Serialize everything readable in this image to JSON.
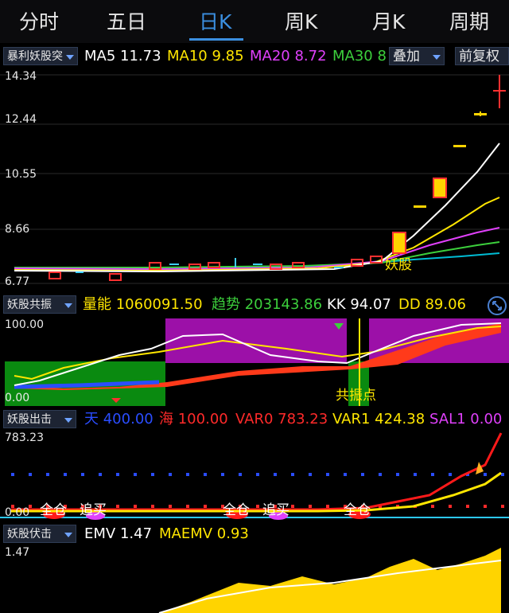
{
  "tabs": [
    "分时",
    "五日",
    "日K",
    "周K",
    "月K",
    "周期"
  ],
  "active_tab": "日K",
  "main_row": {
    "indicator_button": "暴利妖股突",
    "ma": [
      {
        "label": "MA5",
        "value": "11.73",
        "color": "#ffffff"
      },
      {
        "label": "MA10",
        "value": "9.85",
        "color": "#ffe600"
      },
      {
        "label": "MA20",
        "value": "8.72",
        "color": "#e040fb"
      },
      {
        "label": "MA30",
        "value": "8",
        "color": "#3ccf3c"
      }
    ],
    "overlay_button": "叠加",
    "adjust_button": "前复权"
  },
  "main_chart": {
    "y_labels": [
      "14.34",
      "12.44",
      "10.55",
      "8.66",
      "6.77"
    ],
    "annotation": "妖股"
  },
  "panel2_row": {
    "button": "妖股共振",
    "items": [
      {
        "label": "量能",
        "value": "1060091.50",
        "color": "#ffe600"
      },
      {
        "label": "趋势",
        "value": "203143.86",
        "color": "#3ccf3c"
      },
      {
        "label": "KK",
        "value": "94.07",
        "color": "#ffffff"
      },
      {
        "label": "DD",
        "value": "89.06",
        "color": "#ffe600"
      }
    ]
  },
  "panel2": {
    "y_top": "100.00",
    "y_bottom": "0.00",
    "annotation": "共振点"
  },
  "panel3_row": {
    "button": "妖股出击",
    "items": [
      {
        "label": "天",
        "value": "400.00",
        "color": "#2a4dff"
      },
      {
        "label": "海",
        "value": "100.00",
        "color": "#ff2a2a"
      },
      {
        "label": "VAR0",
        "value": "783.23",
        "color": "#ff2a2a"
      },
      {
        "label": "VAR1",
        "value": "424.38",
        "color": "#ffe600"
      },
      {
        "label": "SAL1",
        "value": "0.00",
        "color": "#e040fb"
      }
    ]
  },
  "panel3": {
    "y_top": "783.23",
    "y_bottom": "0.00",
    "labels": [
      "全仓",
      "追买",
      "全仓",
      "追买",
      "全仓"
    ]
  },
  "panel4_row": {
    "button": "妖股伏击",
    "items": [
      {
        "label": "EMV",
        "value": "1.47",
        "color": "#ffffff"
      },
      {
        "label": "MAEMV",
        "value": "0.93",
        "color": "#ffe600"
      }
    ]
  },
  "panel4": {
    "y_top": "1.47"
  }
}
